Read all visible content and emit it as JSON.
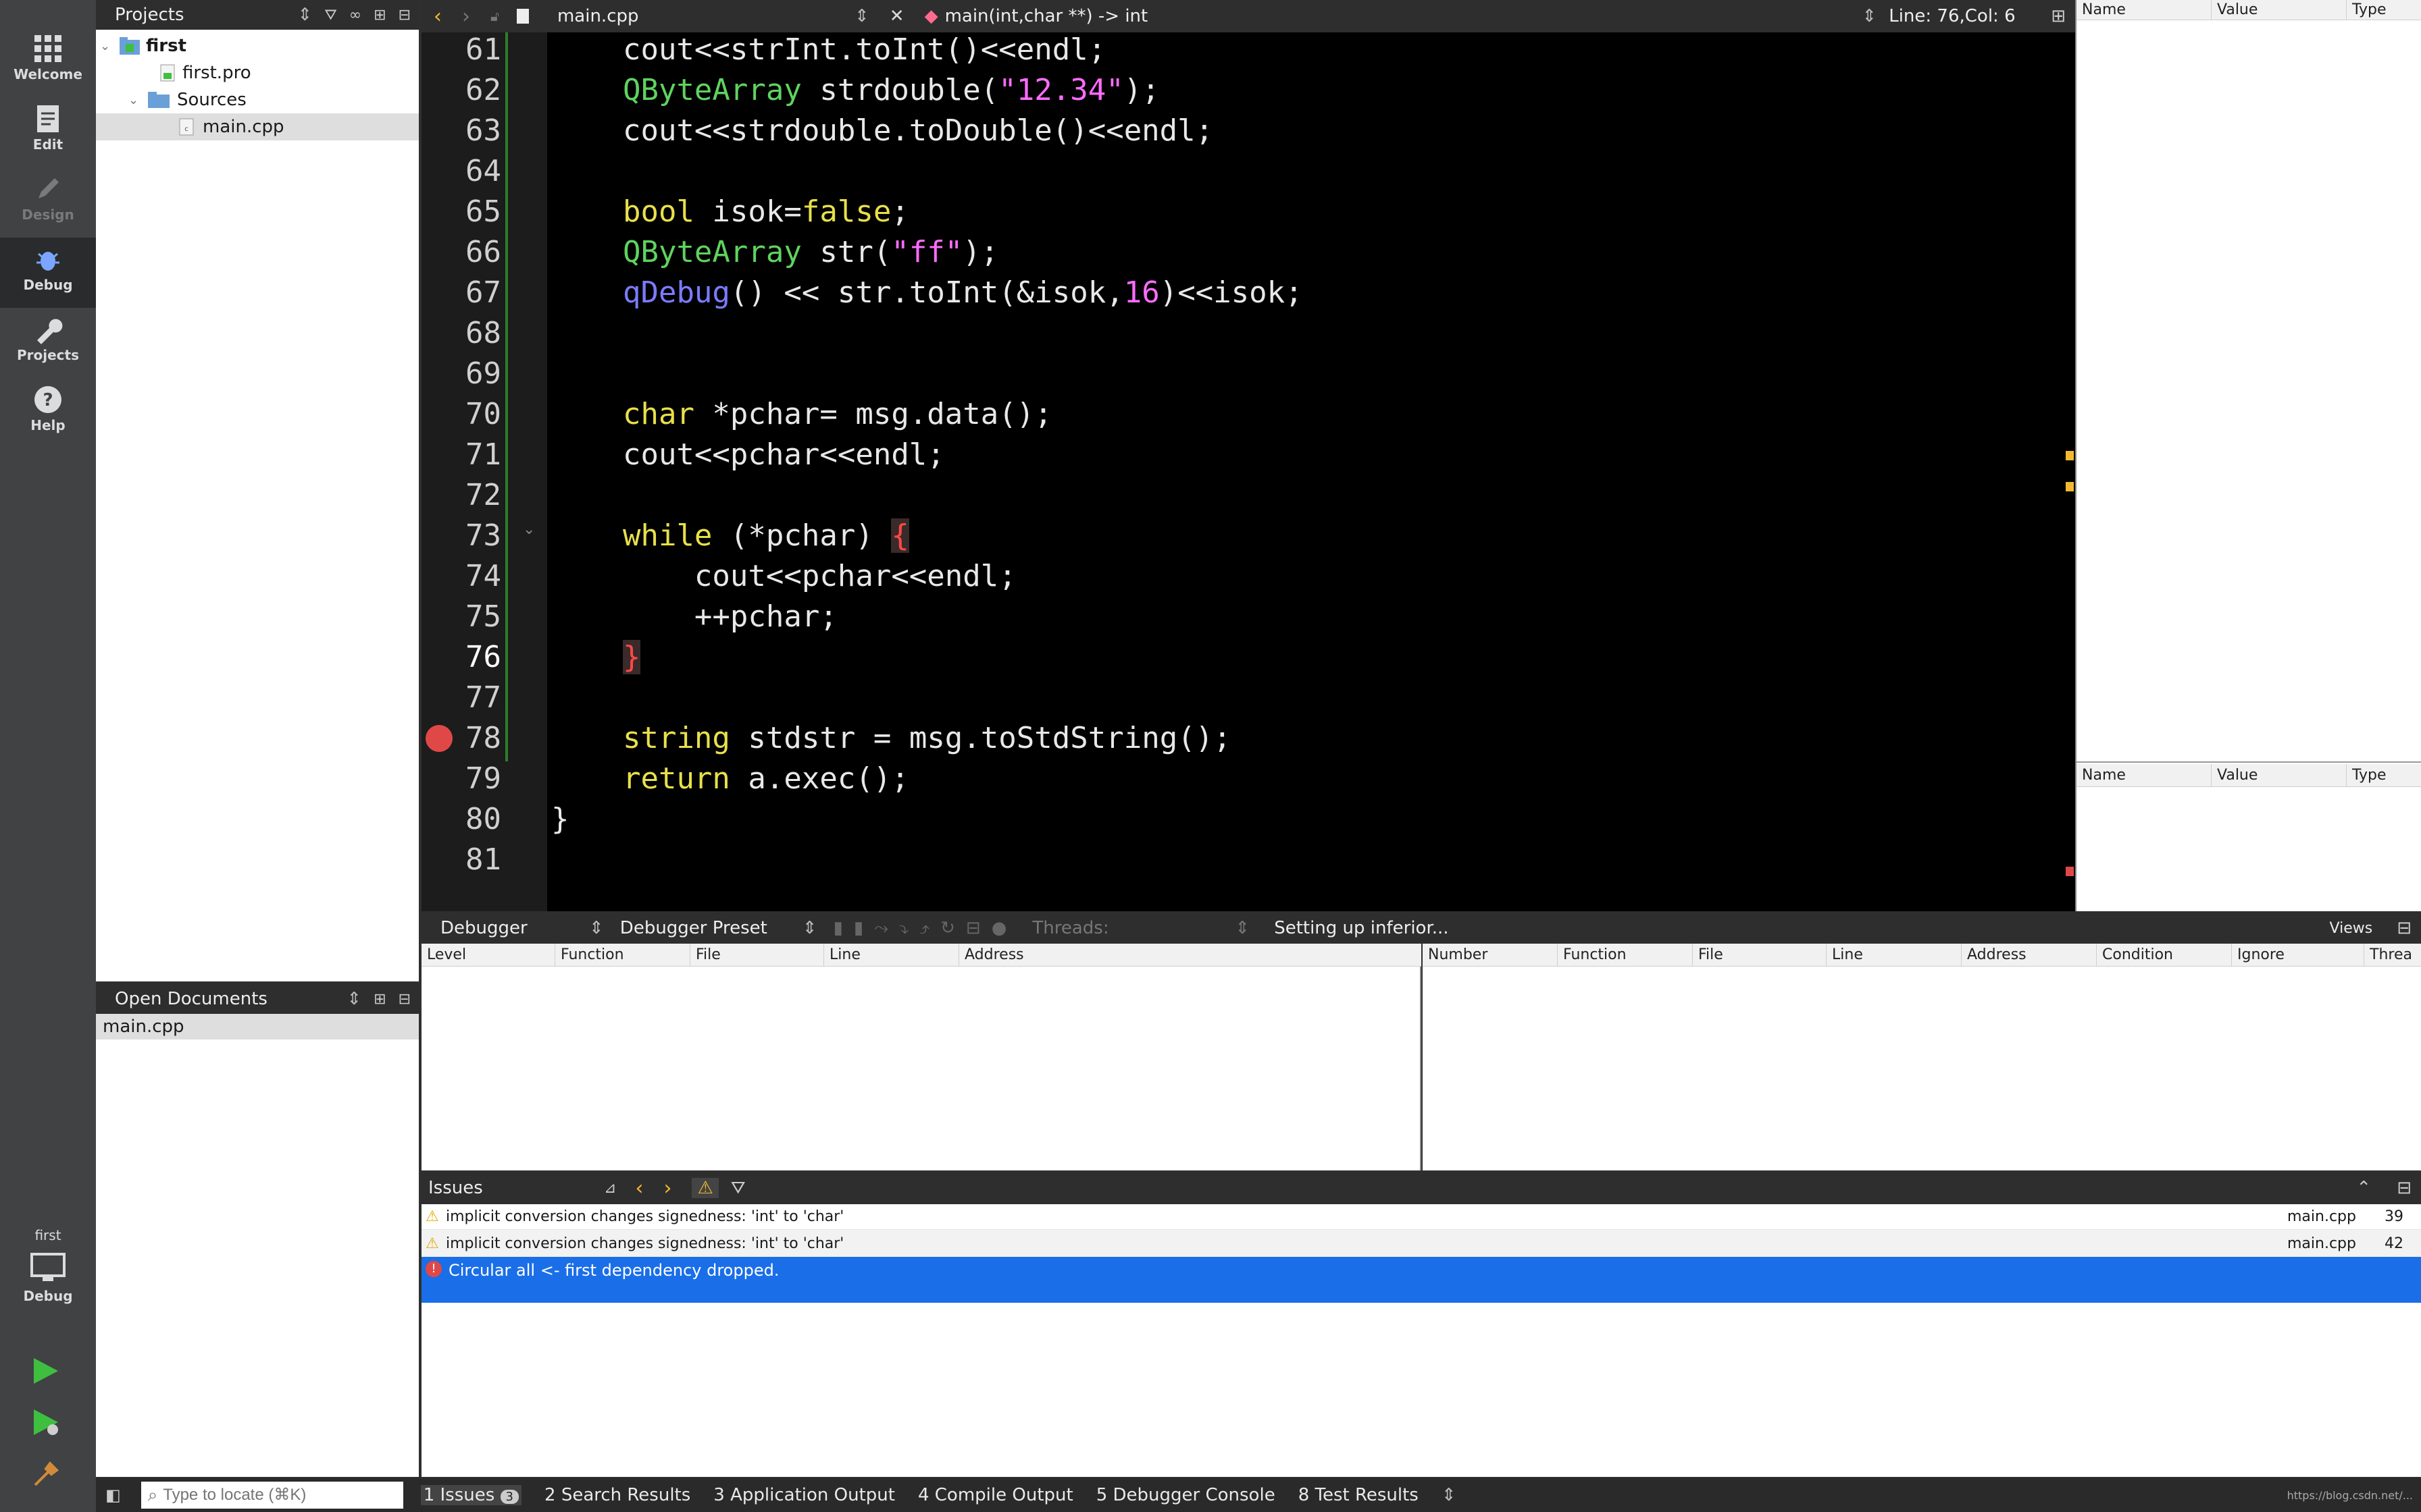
{
  "modes": [
    {
      "label": "Welcome",
      "icon": "grid-icon",
      "state": "normal"
    },
    {
      "label": "Edit",
      "icon": "document-icon",
      "state": "normal"
    },
    {
      "label": "Design",
      "icon": "pencil-icon",
      "state": "disabled"
    },
    {
      "label": "Debug",
      "icon": "bug-icon",
      "state": "active"
    },
    {
      "label": "Projects",
      "icon": "wrench-icon",
      "state": "normal"
    },
    {
      "label": "Help",
      "icon": "help-icon",
      "state": "normal"
    }
  ],
  "target": {
    "project": "first",
    "mode": "Debug"
  },
  "projects": {
    "title": "Projects",
    "tree": [
      {
        "label": "first",
        "level": 0,
        "bold": true,
        "expanded": true
      },
      {
        "label": "first.pro",
        "level": 1
      },
      {
        "label": "Sources",
        "level": 1,
        "expanded": true
      },
      {
        "label": "main.cpp",
        "level": 2,
        "selected": true
      }
    ]
  },
  "open_documents": {
    "title": "Open Documents",
    "items": [
      "main.cpp"
    ]
  },
  "editor_toolbar": {
    "file": "main.cpp",
    "symbol": "main(int,char **) -> int",
    "position": "Line: 76,Col: 6"
  },
  "editor": {
    "lines": [
      "61",
      "62",
      "63",
      "64",
      "65",
      "66",
      "67",
      "68",
      "69",
      "70",
      "71",
      "72",
      "73",
      "74",
      "75",
      "76",
      "77",
      "78",
      "79",
      "80",
      "81"
    ],
    "current_line": "76"
  },
  "right_panels": {
    "top_headers": [
      "Name",
      "Value",
      "Type"
    ],
    "bottom_headers": [
      "Name",
      "Value",
      "Type"
    ]
  },
  "debugger_bar": {
    "debugger": "Debugger",
    "preset": "Debugger Preset",
    "threads_placeholder": "Threads:",
    "status": "Setting up inferior...",
    "views": "Views"
  },
  "stack_headers": [
    "Level",
    "Function",
    "File",
    "Line",
    "Address"
  ],
  "breakpoint_headers": [
    "Number",
    "Function",
    "File",
    "Line",
    "Address",
    "Condition",
    "Ignore",
    "Threa"
  ],
  "issues": {
    "title": "Issues",
    "rows": [
      {
        "severity": "warning",
        "text": "implicit conversion changes signedness: 'int' to 'char'",
        "file": "main.cpp",
        "line": "39"
      },
      {
        "severity": "warning",
        "text": "implicit conversion changes signedness: 'int' to 'char'",
        "file": "main.cpp",
        "line": "42"
      },
      {
        "severity": "error",
        "text": "Circular all <- first dependency dropped.",
        "file": "",
        "line": "",
        "selected": true
      }
    ]
  },
  "bottom_bar": {
    "locator_placeholder": "Type to locate (⌘K)",
    "tabs": [
      {
        "num": "1",
        "label": "Issues",
        "badge": "3"
      },
      {
        "num": "2",
        "label": "Search Results"
      },
      {
        "num": "3",
        "label": "Application Output"
      },
      {
        "num": "4",
        "label": "Compile Output"
      },
      {
        "num": "5",
        "label": "Debugger Console"
      },
      {
        "num": "8",
        "label": "Test Results"
      }
    ],
    "watermark": "https://blog.csdn.net/..."
  },
  "colors": {
    "accent": "#1a6ee8",
    "sidebar": "#404244",
    "editor_bg": "#000000"
  }
}
